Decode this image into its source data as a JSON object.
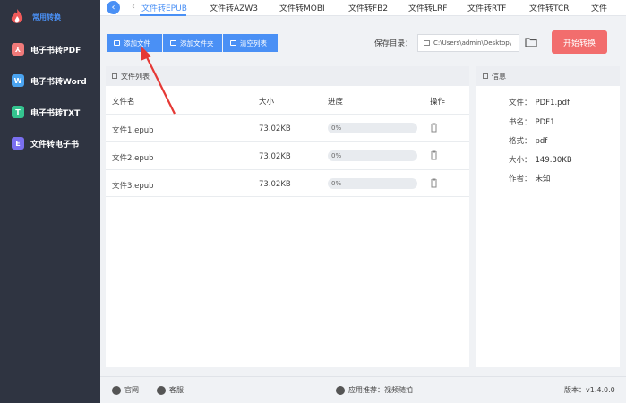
{
  "sidebar": {
    "title": "常用转换",
    "items": [
      {
        "label": "电子书转PDF",
        "badge": "⅄",
        "color": "#f07a7a"
      },
      {
        "label": "电子书转Word",
        "badge": "W",
        "color": "#4aa3f0"
      },
      {
        "label": "电子书转TXT",
        "badge": "T",
        "color": "#34c48f"
      },
      {
        "label": "文件转电子书",
        "badge": "E",
        "color": "#7a6ff0"
      }
    ]
  },
  "tabs": [
    {
      "label": "文件转EPUB",
      "active": true
    },
    {
      "label": "文件转AZW3"
    },
    {
      "label": "文件转MOBI"
    },
    {
      "label": "文件转FB2"
    },
    {
      "label": "文件转LRF"
    },
    {
      "label": "文件转RTF"
    },
    {
      "label": "文件转TCR"
    },
    {
      "label": "文件"
    }
  ],
  "toolbar": {
    "add_file": "添加文件",
    "add_folder": "添加文件夹",
    "clear_list": "清空列表",
    "save_dir_label": "保存目录：",
    "save_path": "C:\\Users\\admin\\Desktop\\",
    "start_button": "开始转换"
  },
  "file_list": {
    "title": "文件列表",
    "columns": [
      "文件名",
      "大小",
      "进度",
      "操作"
    ],
    "rows": [
      {
        "name": "文件1.epub",
        "size": "73.02KB",
        "progress": "0%"
      },
      {
        "name": "文件2.epub",
        "size": "73.02KB",
        "progress": "0%"
      },
      {
        "name": "文件3.epub",
        "size": "73.02KB",
        "progress": "0%"
      }
    ]
  },
  "info": {
    "title": "信息",
    "rows": [
      {
        "label": "文件：",
        "value": "PDF1.pdf"
      },
      {
        "label": "书名：",
        "value": "PDF1"
      },
      {
        "label": "格式：",
        "value": "pdf"
      },
      {
        "label": "大小：",
        "value": "149.30KB"
      },
      {
        "label": "作者：",
        "value": "未知"
      }
    ]
  },
  "footer": {
    "website": "官网",
    "support": "客服",
    "app_recommend": "应用推荐：视频随拍",
    "version": "版本：v1.4.0.0"
  },
  "colors": {
    "accent": "#4a90f5",
    "start": "#f26d6d",
    "sidebar_bg": "#2f3441",
    "annotation": "#e53935"
  }
}
